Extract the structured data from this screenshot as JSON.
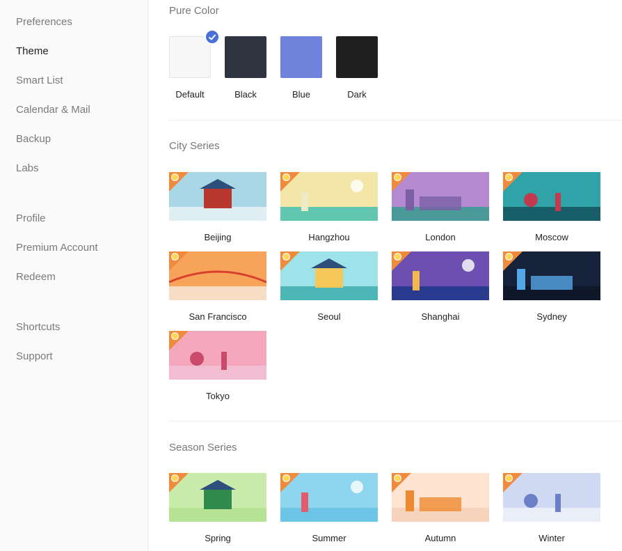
{
  "sidebar": {
    "items": [
      {
        "label": "Preferences"
      },
      {
        "label": "Theme"
      },
      {
        "label": "Smart List"
      },
      {
        "label": "Calendar & Mail"
      },
      {
        "label": "Backup"
      },
      {
        "label": "Labs"
      },
      {
        "label": "Profile"
      },
      {
        "label": "Premium Account"
      },
      {
        "label": "Redeem"
      },
      {
        "label": "Shortcuts"
      },
      {
        "label": "Support"
      }
    ],
    "active": "Theme"
  },
  "pure_color": {
    "title": "Pure Color",
    "swatches": [
      {
        "label": "Default",
        "color": "#f7f7f7",
        "selected": true
      },
      {
        "label": "Black",
        "color": "#2f3441",
        "selected": false
      },
      {
        "label": "Blue",
        "color": "#6f82dc",
        "selected": false
      },
      {
        "label": "Dark",
        "color": "#1f1f1f",
        "selected": false
      }
    ]
  },
  "city_series": {
    "title": "City Series",
    "themes": [
      {
        "label": "Beijing",
        "premium": true,
        "sky": "#a9d7e6",
        "ground": "#dfeef2",
        "accent": "#b8372f"
      },
      {
        "label": "Hangzhou",
        "premium": true,
        "sky": "#f3e6a8",
        "ground": "#62c7b0",
        "accent": "#eee9c7"
      },
      {
        "label": "London",
        "premium": true,
        "sky": "#b58ad0",
        "ground": "#4b9a9a",
        "accent": "#7a5fa5"
      },
      {
        "label": "Moscow",
        "premium": true,
        "sky": "#2fa3a8",
        "ground": "#175e68",
        "accent": "#c23a4e"
      },
      {
        "label": "San Francisco",
        "premium": true,
        "sky": "#f7a45a",
        "ground": "#f6ddc3",
        "accent": "#d8412b"
      },
      {
        "label": "Seoul",
        "premium": true,
        "sky": "#9ee3ea",
        "ground": "#4cb7b6",
        "accent": "#f6c85a"
      },
      {
        "label": "Shanghai",
        "premium": true,
        "sky": "#6c4fb0",
        "ground": "#2a3b8f",
        "accent": "#f2b84b"
      },
      {
        "label": "Sydney",
        "premium": true,
        "sky": "#16223a",
        "ground": "#0f1828",
        "accent": "#52a8e6"
      },
      {
        "label": "Tokyo",
        "premium": true,
        "sky": "#f5a8bd",
        "ground": "#f2bdd0",
        "accent": "#c94a6b"
      }
    ]
  },
  "season_series": {
    "title": "Season Series",
    "themes": [
      {
        "label": "Spring",
        "premium": true,
        "sky": "#c9ecab",
        "ground": "#b6e294",
        "accent": "#2f8a4b"
      },
      {
        "label": "Summer",
        "premium": true,
        "sky": "#8ed6ef",
        "ground": "#6cc4e6",
        "accent": "#e45b6b"
      },
      {
        "label": "Autumn",
        "premium": true,
        "sky": "#fde3d0",
        "ground": "#f8d3bb",
        "accent": "#ee8a2f"
      },
      {
        "label": "Winter",
        "premium": true,
        "sky": "#cfd9f2",
        "ground": "#e9eef9",
        "accent": "#6b7fc6"
      }
    ]
  }
}
